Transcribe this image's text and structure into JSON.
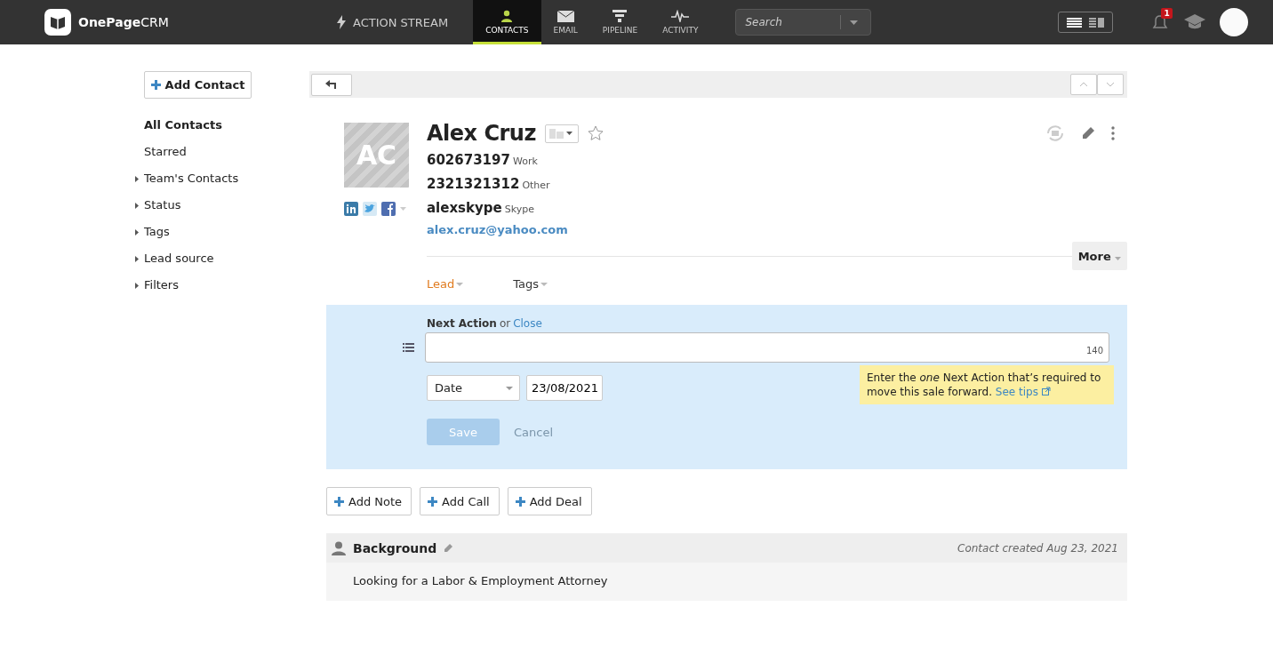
{
  "header": {
    "logo": {
      "brand": "OnePage",
      "suffix": "CRM"
    },
    "nav": [
      {
        "label": "ACTION STREAM",
        "kind": "stream",
        "selected": false
      },
      {
        "label": "CONTACTS",
        "kind": "contacts",
        "selected": true
      },
      {
        "label": "EMAIL",
        "kind": "email",
        "selected": false
      },
      {
        "label": "PIPELINE",
        "kind": "pipeline",
        "selected": false
      },
      {
        "label": "ACTIVITY",
        "kind": "activity",
        "selected": false
      }
    ],
    "search": {
      "placeholder": "Search"
    },
    "views": [
      {
        "kind": "list",
        "selected": true
      },
      {
        "kind": "split",
        "selected": false
      }
    ],
    "notifications": {
      "count": "1"
    }
  },
  "sidebar": {
    "add_button": "Add Contact",
    "items": [
      {
        "label": "All Contacts",
        "selected": true,
        "expandable": false
      },
      {
        "label": "Starred",
        "selected": false,
        "expandable": false
      },
      {
        "label": "Team's Contacts",
        "selected": false,
        "expandable": true
      },
      {
        "label": "Status",
        "selected": false,
        "expandable": true
      },
      {
        "label": "Tags",
        "selected": false,
        "expandable": true
      },
      {
        "label": "Lead source",
        "selected": false,
        "expandable": true
      },
      {
        "label": "Filters",
        "selected": false,
        "expandable": true
      }
    ]
  },
  "contact": {
    "initials": "AC",
    "name": "Alex Cruz",
    "starred": false,
    "details": [
      {
        "value": "602673197",
        "label": "Work"
      },
      {
        "value": "2321321312",
        "label": "Other"
      },
      {
        "value": "alexskype",
        "label": "Skype"
      }
    ],
    "email": "alex.cruz@yahoo.com",
    "more": "More",
    "status": "Lead",
    "tags": "Tags"
  },
  "next_action": {
    "title": "Next Action",
    "or": "or",
    "close": "Close",
    "counter": "140",
    "date_select": "Date",
    "date_value": "23/08/2021",
    "save": "Save",
    "cancel": "Cancel",
    "save_disabled": true,
    "tip": {
      "text": "Enter the *one* Next Action that’s required to move this sale forward.",
      "link": "See tips"
    }
  },
  "actions": [
    "Add Note",
    "Add Call",
    "Add Deal"
  ],
  "background": {
    "title": "Background",
    "created": "Contact created Aug 23, 2021",
    "text": "Looking for a Labor & Employment Attorney"
  }
}
